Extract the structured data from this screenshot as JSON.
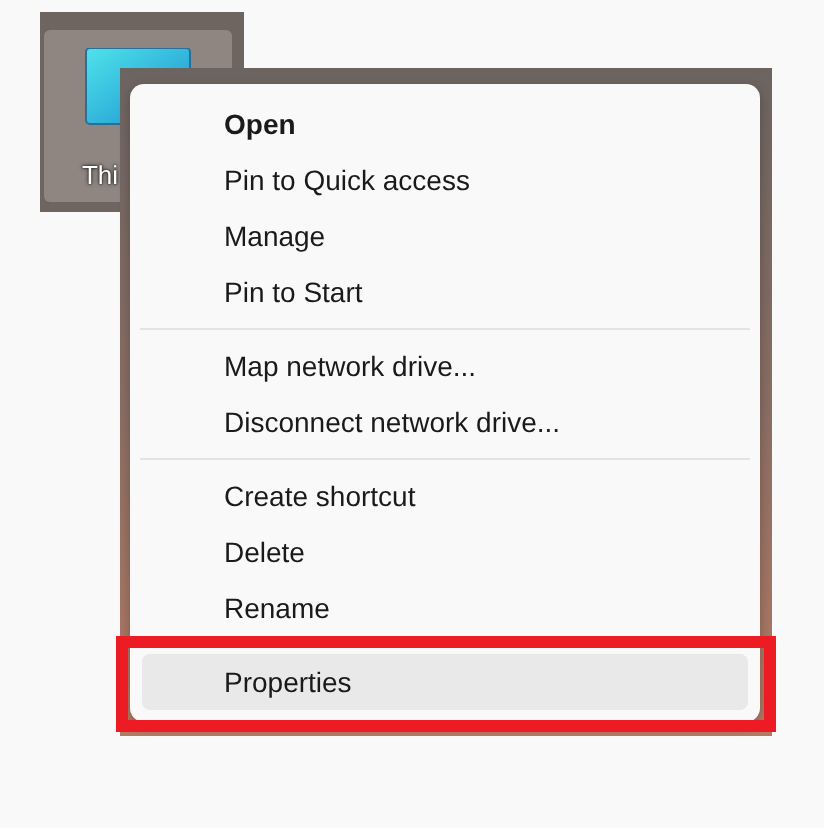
{
  "desktop_icon": {
    "label": "Thi",
    "selected": true
  },
  "context_menu": {
    "groups": [
      {
        "items": [
          {
            "label": "Open",
            "default": true,
            "hovered": false,
            "outlined": false
          },
          {
            "label": "Pin to Quick access",
            "default": false,
            "hovered": false,
            "outlined": false
          },
          {
            "label": "Manage",
            "default": false,
            "hovered": false,
            "outlined": false
          },
          {
            "label": "Pin to Start",
            "default": false,
            "hovered": false,
            "outlined": false
          }
        ]
      },
      {
        "items": [
          {
            "label": "Map network drive...",
            "default": false,
            "hovered": false,
            "outlined": false
          },
          {
            "label": "Disconnect network drive...",
            "default": false,
            "hovered": false,
            "outlined": false
          }
        ]
      },
      {
        "items": [
          {
            "label": "Create shortcut",
            "default": false,
            "hovered": false,
            "outlined": false
          },
          {
            "label": "Delete",
            "default": false,
            "hovered": false,
            "outlined": false
          },
          {
            "label": "Rename",
            "default": false,
            "hovered": false,
            "outlined": false
          }
        ]
      },
      {
        "items": [
          {
            "label": "Properties",
            "default": false,
            "hovered": true,
            "outlined": true
          }
        ]
      }
    ]
  }
}
